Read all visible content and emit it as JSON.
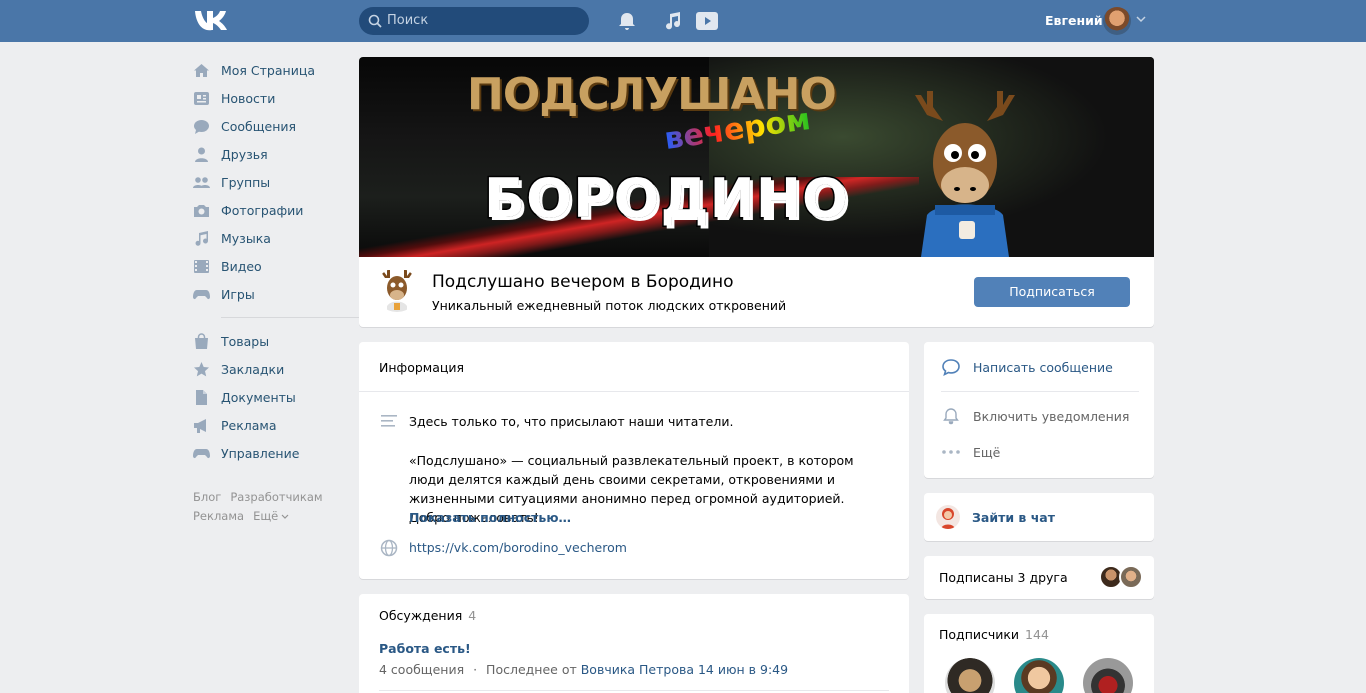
{
  "header": {
    "logo_icon": "vk-logo-icon",
    "search_placeholder": "Поиск",
    "user_name": "Евгений",
    "icons": [
      "search-icon",
      "bell-icon",
      "music-note-icon",
      "play-icon",
      "chevron-down-icon"
    ],
    "bg_color": "#4a76a8"
  },
  "nav": {
    "items": [
      {
        "label": "Моя Страница",
        "icon": "home-icon"
      },
      {
        "label": "Новости",
        "icon": "news-icon"
      },
      {
        "label": "Сообщения",
        "icon": "messages-icon"
      },
      {
        "label": "Друзья",
        "icon": "friends-icon"
      },
      {
        "label": "Группы",
        "icon": "groups-icon"
      },
      {
        "label": "Фотографии",
        "icon": "camera-icon"
      },
      {
        "label": "Музыка",
        "icon": "music-icon"
      },
      {
        "label": "Видео",
        "icon": "video-icon"
      },
      {
        "label": "Игры",
        "icon": "gamepad-icon"
      }
    ],
    "items2": [
      {
        "label": "Товары",
        "icon": "bag-icon"
      },
      {
        "label": "Закладки",
        "icon": "star-icon"
      },
      {
        "label": "Документы",
        "icon": "document-icon"
      },
      {
        "label": "Реклама",
        "icon": "megaphone-icon"
      },
      {
        "label": "Управление",
        "icon": "gamepad-icon"
      }
    ],
    "footer": [
      "Блог",
      "Разработчикам",
      "Реклама",
      "Ещё"
    ]
  },
  "cover": {
    "title_line1": "ПОДСЛУШАНО",
    "title_line2": "вечером",
    "title_line3": "БОРОДИНО"
  },
  "group": {
    "name": "Подслушано вечером в Бородино",
    "status": "Уникальный ежедневный поток людских откровений",
    "subscribe_label": "Подписаться"
  },
  "info": {
    "title": "Информация",
    "paragraph1": "Здесь только то, что присылают наши читатели.",
    "paragraph2": "«Подслушано» — социальный развлекательный проект, в котором люди делятся каждый день своими секретами, откровениями и жизненными ситуациями анонимно перед огромной аудиторией. Добро пожаловать!",
    "show_more": "Показать полностью…",
    "website": "https://vk.com/borodino_vecherom"
  },
  "discussions": {
    "title": "Обсуждения",
    "count": "4",
    "topic": "Работа есть!",
    "posts": "4 сообщения",
    "dot": "·",
    "last_prefix": "Последнее от",
    "last_author": "Вовчика Петрова",
    "last_time": "14 июн в 9:49"
  },
  "actions": {
    "write": "Написать сообщение",
    "notify": "Включить уведомления",
    "more": "Ещё"
  },
  "chat": {
    "label": "Зайти в чат"
  },
  "friends": {
    "label": "Подписаны 3 друга"
  },
  "subscribers": {
    "title": "Подписчики",
    "count": "144"
  }
}
